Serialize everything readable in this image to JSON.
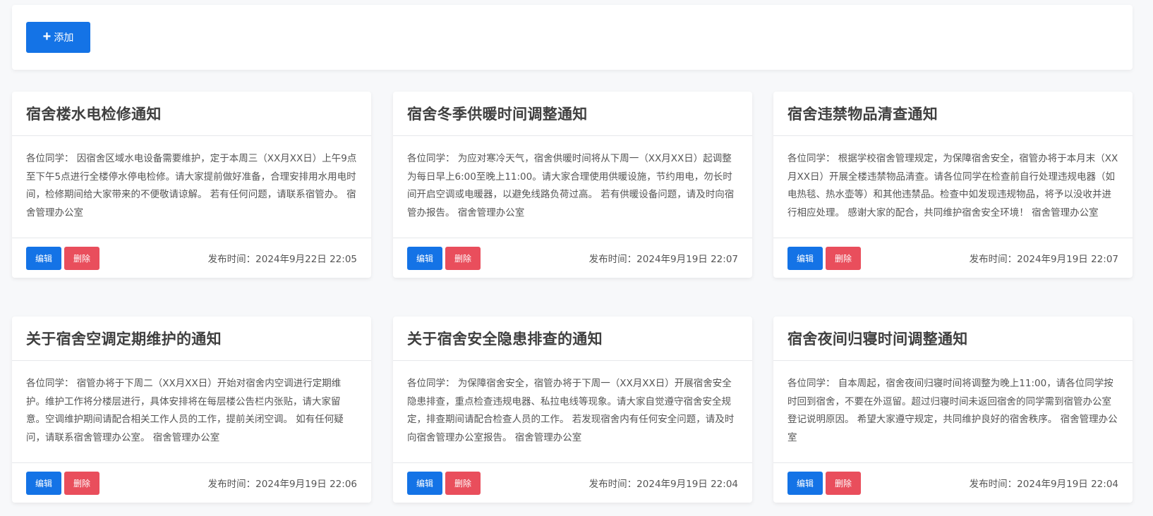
{
  "toolbar": {
    "add_label": "添加"
  },
  "buttons": {
    "edit": "编辑",
    "delete": "删除"
  },
  "colors": {
    "primary": "#1473e6",
    "danger": "#e94e5c"
  },
  "cards": [
    {
      "title": "宿舍楼水电检修通知",
      "content": "各位同学： 因宿舍区域水电设备需要维护，定于本周三（XX月XX日）上午9点至下午5点进行全楼停水停电检修。请大家提前做好准备，合理安排用水用电时间，检修期间给大家带来的不便敬请谅解。 若有任何问题，请联系宿管办。 宿舍管理办公室",
      "date": "发布时间：2024年9月22日 22:05"
    },
    {
      "title": "宿舍冬季供暖时间调整通知",
      "content": "各位同学： 为应对寒冷天气，宿舍供暖时间将从下周一（XX月XX日）起调整为每日早上6:00至晚上11:00。请大家合理使用供暖设施，节约用电，勿长时间开启空调或电暖器，以避免线路负荷过高。 若有供暖设备问题，请及时向宿管办报告。 宿舍管理办公室",
      "date": "发布时间：2024年9月19日 22:07"
    },
    {
      "title": "宿舍违禁物品清查通知",
      "content": "各位同学： 根据学校宿舍管理规定，为保障宿舍安全，宿管办将于本月末（XX月XX日）开展全楼违禁物品清查。请各位同学在检查前自行处理违规电器（如电热毯、热水壶等）和其他违禁品。检查中如发现违规物品，将予以没收并进行相应处理。 感谢大家的配合，共同维护宿舍安全环境！ 宿舍管理办公室",
      "date": "发布时间：2024年9月19日 22:07"
    },
    {
      "title": "关于宿舍空调定期维护的通知",
      "content": "各位同学： 宿管办将于下周二（XX月XX日）开始对宿舍内空调进行定期维护。维护工作将分楼层进行，具体安排将在每层楼公告栏内张贴，请大家留意。空调维护期间请配合相关工作人员的工作，提前关闭空调。 如有任何疑问，请联系宿舍管理办公室。 宿舍管理办公室",
      "date": "发布时间：2024年9月19日 22:06"
    },
    {
      "title": "关于宿舍安全隐患排查的通知",
      "content": "各位同学： 为保障宿舍安全，宿管办将于下周一（XX月XX日）开展宿舍安全隐患排查，重点检查违规电器、私拉电线等现象。请大家自觉遵守宿舍安全规定，排查期间请配合检查人员的工作。 若发现宿舍内有任何安全问题，请及时向宿舍管理办公室报告。 宿舍管理办公室",
      "date": "发布时间：2024年9月19日 22:04"
    },
    {
      "title": "宿舍夜间归寝时间调整通知",
      "content": "各位同学： 自本周起，宿舍夜间归寝时间将调整为晚上11:00，请各位同学按时回到宿舍，不要在外逗留。超过归寝时间未返回宿舍的同学需到宿管办公室登记说明原因。 希望大家遵守规定，共同维护良好的宿舍秩序。 宿舍管理办公室",
      "date": "发布时间：2024年9月19日 22:04"
    }
  ]
}
